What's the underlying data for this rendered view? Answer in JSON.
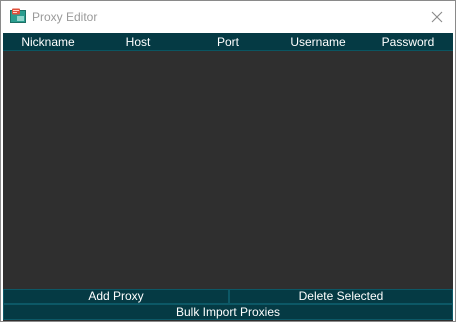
{
  "window": {
    "title": "Proxy Editor",
    "app_icon": "proxy-app-icon",
    "close_icon": "close-icon"
  },
  "table": {
    "columns": [
      "Nickname",
      "Host",
      "Port",
      "Username",
      "Password"
    ],
    "rows": []
  },
  "buttons": {
    "add_proxy": "Add Proxy",
    "delete_selected": "Delete Selected",
    "bulk_import": "Bulk Import Proxies"
  },
  "colors": {
    "header_bg": "#053a44",
    "list_bg": "#2f2f2f",
    "button_bg": "#053a44",
    "text": "#ffffff"
  }
}
